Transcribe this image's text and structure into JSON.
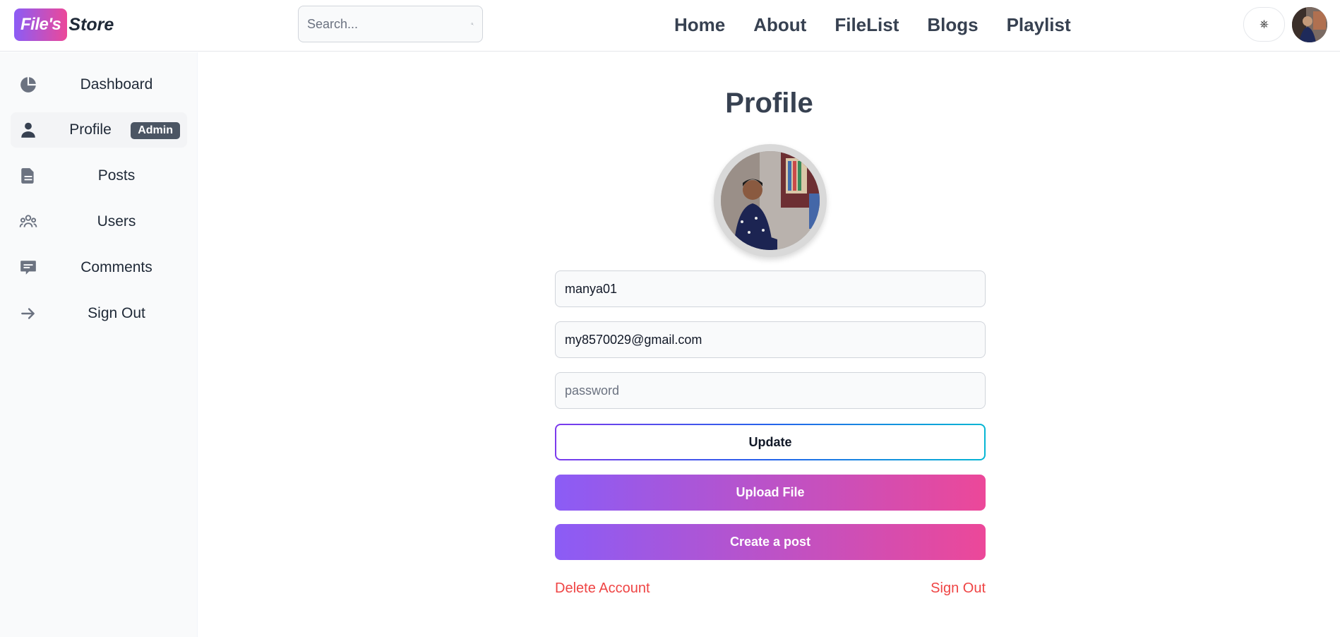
{
  "header": {
    "logo_badge": "File's",
    "logo_text": "Store",
    "search_placeholder": "Search...",
    "nav": [
      "Home",
      "About",
      "FileList",
      "Blogs",
      "Playlist"
    ],
    "theme_toggle": "⎈"
  },
  "sidebar": {
    "items": [
      {
        "label": "Dashboard",
        "icon": "pie-chart-icon"
      },
      {
        "label": "Profile",
        "icon": "user-icon",
        "badge": "Admin",
        "active": true
      },
      {
        "label": "Posts",
        "icon": "document-icon"
      },
      {
        "label": "Users",
        "icon": "users-group-icon"
      },
      {
        "label": "Comments",
        "icon": "comment-icon"
      },
      {
        "label": "Sign Out",
        "icon": "arrow-right-icon"
      }
    ]
  },
  "main": {
    "title": "Profile",
    "username_value": "manya01",
    "email_value": "my8570029@gmail.com",
    "password_placeholder": "password",
    "update_label": "Update",
    "upload_label": "Upload File",
    "create_post_label": "Create a post",
    "delete_account_label": "Delete Account",
    "sign_out_label": "Sign Out"
  },
  "colors": {
    "gradient_start": "#8b5cf6",
    "gradient_end": "#ec4899",
    "danger": "#ef4444",
    "badge_bg": "#4b5563"
  }
}
